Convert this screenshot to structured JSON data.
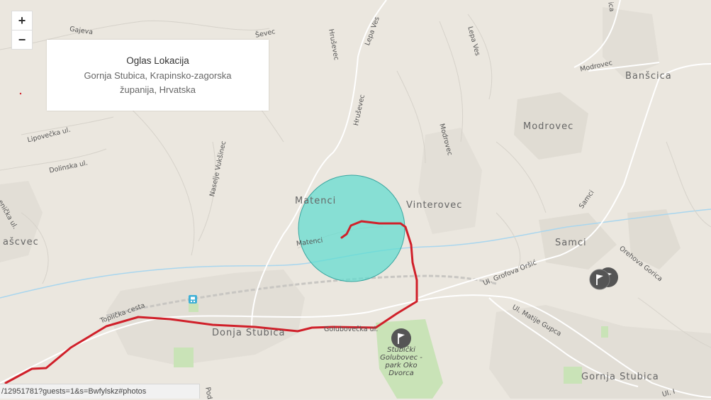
{
  "map": {
    "zoom_in_label": "+",
    "zoom_out_label": "−",
    "route_color": "#d0202a",
    "area_color": "#5fdcd0",
    "info_box": {
      "title": "Oglas Lokacija",
      "address": "Gornja Stubica,  Krapinsko-zagorska županija,  Hrvatska"
    },
    "places": [
      {
        "name": "Banšcica"
      },
      {
        "name": "Modrovec"
      },
      {
        "name": "Vinterovec"
      },
      {
        "name": "Matenci"
      },
      {
        "name": "Samci"
      },
      {
        "name": "ašcvec"
      },
      {
        "name": "Donja Stubica"
      },
      {
        "name": "Gornja Stubica"
      }
    ],
    "streets": [
      {
        "name": "Gajeva"
      },
      {
        "name": "Ševec"
      },
      {
        "name": "Hruševec"
      },
      {
        "name": "Lepa Ves"
      },
      {
        "name": "Lepa Ves"
      },
      {
        "name": "Modrovec"
      },
      {
        "name": "Hruševec"
      },
      {
        "name": "Modrovec"
      },
      {
        "name": "Lipovečka ul."
      },
      {
        "name": "Dolinska ul."
      },
      {
        "name": "Naselje Vukšinec"
      },
      {
        "name": "Matenci"
      },
      {
        "name": "Samci"
      },
      {
        "name": "Orehova Gorica"
      },
      {
        "name": "Ul. Grofova Oršić"
      },
      {
        "name": "Ul. Matije Gupca"
      },
      {
        "name": "Toplička cesta"
      },
      {
        "name": "Golubovečka ul."
      },
      {
        "name": "Ul. I"
      },
      {
        "name": "Pod"
      },
      {
        "name": "enička ul."
      },
      {
        "name": "ica"
      }
    ],
    "poi": {
      "name": "Stubički Golubovec - park Oko Dvorca"
    },
    "markers": [
      {
        "icon": "flag-marker-icon"
      },
      {
        "icon": "flag-marker-icon"
      },
      {
        "icon": "flag-marker-icon"
      },
      {
        "icon": "bus-stop-icon"
      }
    ]
  },
  "status_bar": {
    "url": "/12951781?guests=1&s=Bwfylskz#photos"
  }
}
